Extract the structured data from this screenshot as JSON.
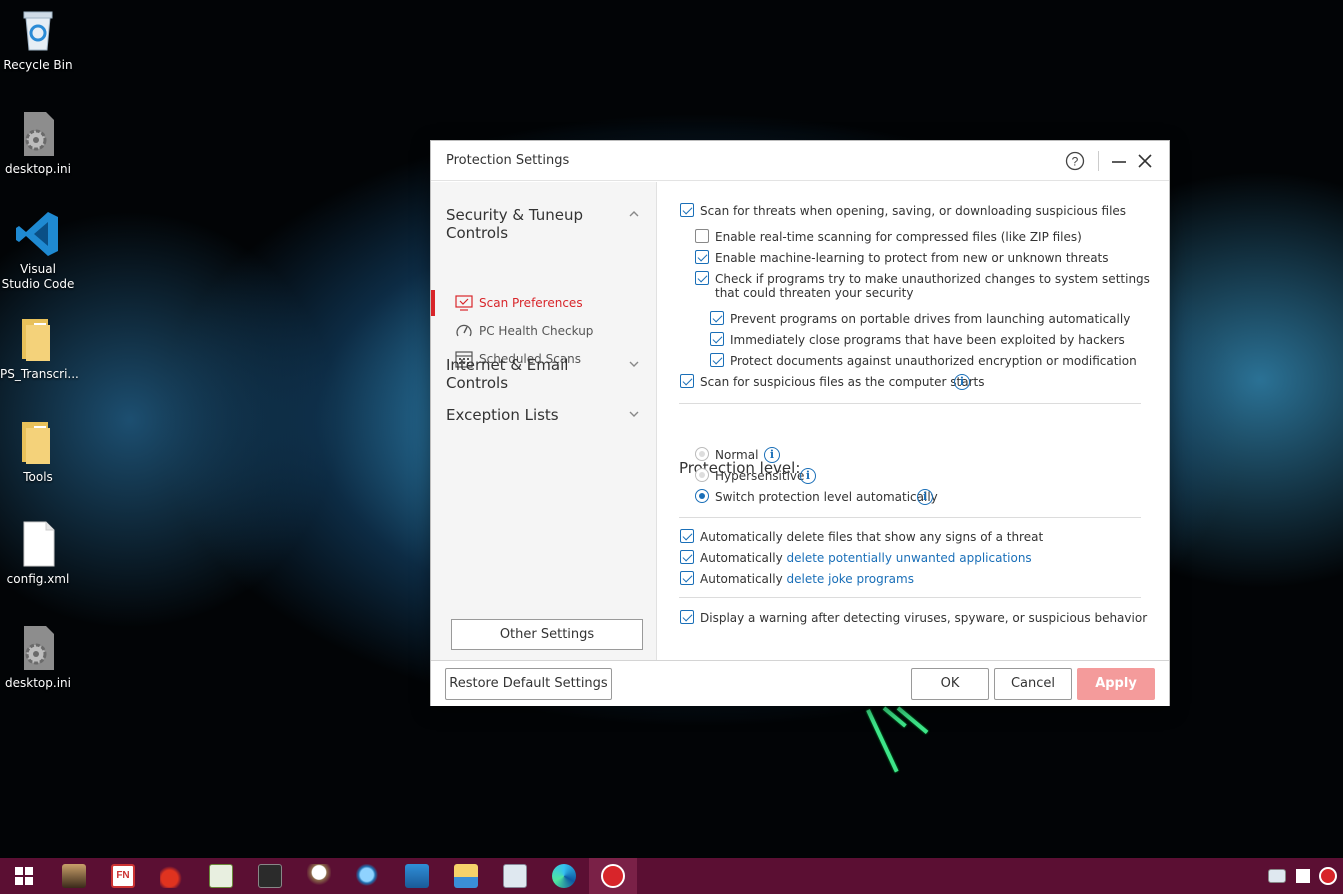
{
  "desktop": {
    "icons": [
      {
        "label": "Recycle Bin",
        "icon": "recycle-bin-icon"
      },
      {
        "label": "desktop.ini",
        "icon": "settings-file-icon"
      },
      {
        "label": "Visual Studio Code",
        "icon": "vscode-icon"
      },
      {
        "label": "PS_Transcri...",
        "icon": "folder-icon"
      },
      {
        "label": "Tools",
        "icon": "folder-icon"
      },
      {
        "label": "config.xml",
        "icon": "file-icon"
      },
      {
        "label": "desktop.ini",
        "icon": "settings-file-icon"
      }
    ]
  },
  "dialog": {
    "title": "Protection Settings",
    "help_icon": "?",
    "minimize_icon": "—",
    "close_icon": "✕",
    "sidebar": {
      "section1": "Security & Tuneup Controls",
      "items": [
        {
          "label": "Scan Preferences",
          "icon": "monitor-check-icon",
          "active": true
        },
        {
          "label": "PC Health Checkup",
          "icon": "gauge-icon",
          "active": false
        },
        {
          "label": "Scheduled Scans",
          "icon": "calendar-icon",
          "active": false
        }
      ],
      "section2": "Internet & Email Controls",
      "section3": "Exception Lists",
      "other_settings": "Other Settings"
    },
    "options": {
      "scan_suspicious": "Scan for threats when opening, saving, or downloading suspicious files",
      "realtime_compressed": "Enable real-time scanning for compressed files (like ZIP files)",
      "machine_learning": "Enable machine-learning to protect from new or unknown threats",
      "unauthorized_changes_1": "Check if programs try to make unauthorized changes to system settings",
      "unauthorized_changes_2": "that could threaten your security",
      "portable_drives": "Prevent programs on portable drives from launching automatically",
      "close_exploited": "Immediately close programs that have been exploited by hackers",
      "protect_documents": "Protect documents against unauthorized encryption or modification",
      "scan_startup": "Scan for suspicious files as the computer starts"
    },
    "protection_level": {
      "heading": "Protection level:",
      "normal": "Normal",
      "hypersensitive": "Hypersensitive",
      "auto": "Switch protection level automatically"
    },
    "auto_delete": {
      "files": "Automatically delete files that show any signs of a threat",
      "pua_prefix": "Automatically ",
      "pua_link": "delete potentially unwanted applications",
      "joke_prefix": "Automatically ",
      "joke_link": "delete joke programs"
    },
    "display_warning": "Display a warning after detecting viruses, spyware, or suspicious behavior",
    "footer": {
      "restore": "Restore Default Settings",
      "ok": "OK",
      "cancel": "Cancel",
      "apply": "Apply"
    }
  },
  "taskbar": {
    "start_icon": "windows-start-icon",
    "apps": [
      "app-portrait-icon",
      "fn-app-icon",
      "chili-icon",
      "notepad-chart-icon",
      "terminal-icon",
      "chef-icon",
      "magnifier-icon",
      "monitor-icon",
      "file-explorer-icon",
      "photo-viewer-icon",
      "edge-icon",
      "trend-micro-icon"
    ],
    "fn_label": "FN"
  },
  "colors": {
    "accent_red": "#d8252a",
    "link_blue": "#1a6fb8",
    "apply_disabled": "#f49b9b",
    "taskbar": "#5b0f33"
  }
}
